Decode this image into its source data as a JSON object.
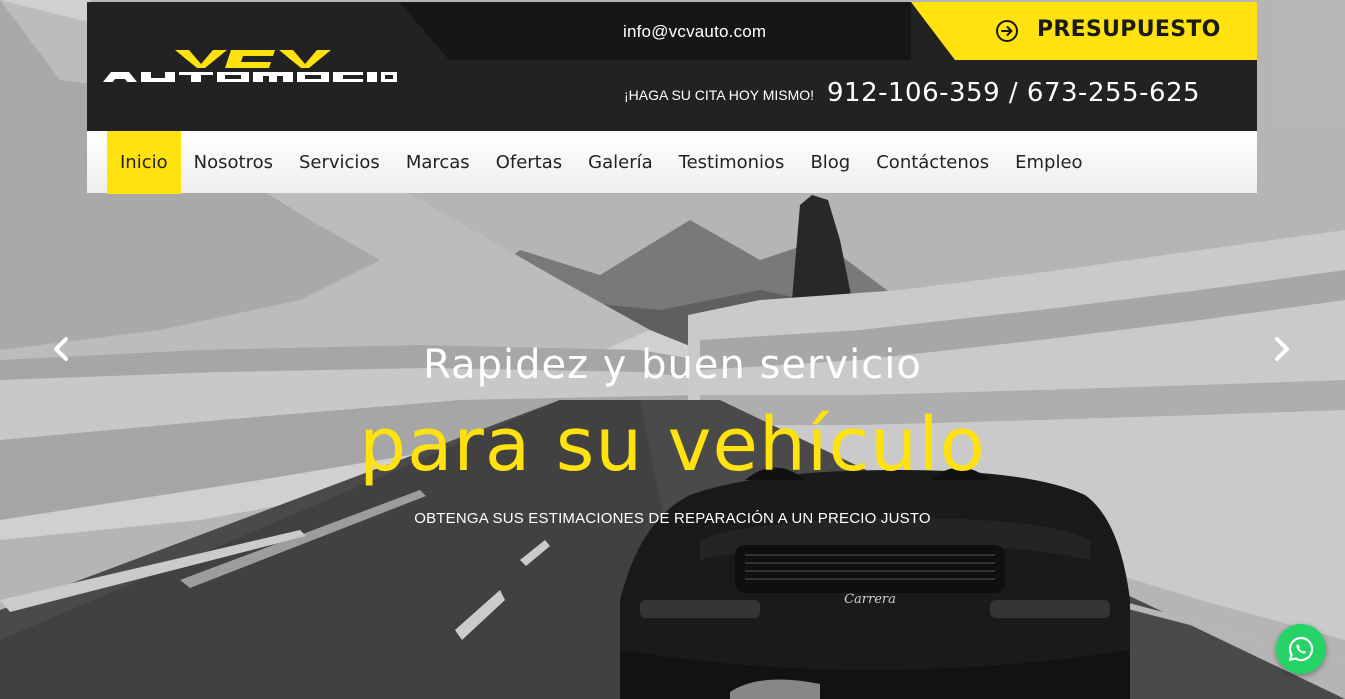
{
  "header": {
    "logo_text": "VCV AUTOMOCION",
    "email": "info@vcvauto.com",
    "quote_button": "PRESUPUESTO",
    "appointment_label": "¡HAGA SU CITA HOY MISMO!",
    "phones": "912-106-359 / 673-255-625"
  },
  "nav": {
    "items": [
      "Inicio",
      "Nosotros",
      "Servicios",
      "Marcas",
      "Ofertas",
      "Galería",
      "Testimonios",
      "Blog",
      "Contáctenos",
      "Empleo"
    ],
    "active": "Inicio"
  },
  "hero": {
    "title": "Rapidez y buen servicio",
    "highlight": "para su vehículo",
    "subtitle": "OBTENGA SUS ESTIMACIONES DE REPARACIÓN A UN PRECIO JUSTO",
    "car_badge": "Carrera"
  },
  "icons": {
    "prev": "chevron-left-icon",
    "next": "chevron-right-icon",
    "quote": "arrow-circle-right-icon",
    "chat": "whatsapp-icon"
  },
  "colors": {
    "accent": "#ffe20e",
    "header_bg": "#222222",
    "nav_bg": "#ffffff",
    "whatsapp": "#25d366"
  }
}
